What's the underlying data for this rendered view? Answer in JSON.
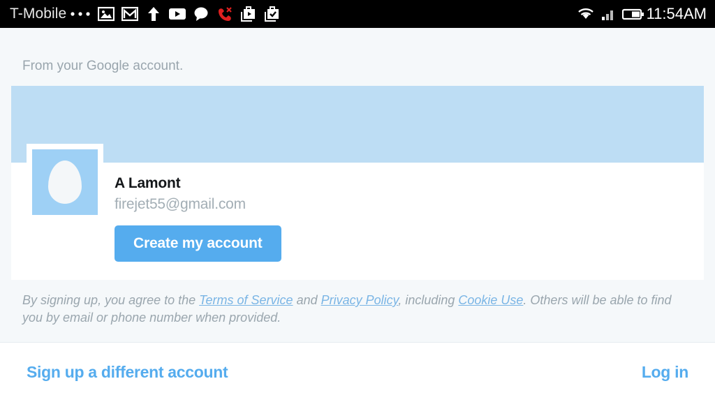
{
  "status_bar": {
    "carrier": "T-Mobile",
    "clock": "11:54AM",
    "icons": [
      "overflow-dots-icon",
      "photo-icon",
      "gmail-icon",
      "upload-arrow-icon",
      "youtube-icon",
      "message-bubble-icon",
      "missed-call-icon",
      "play-store-download-icon",
      "play-store-installed-icon"
    ],
    "right_icons": [
      "wifi-icon",
      "signal-icon",
      "battery-icon"
    ],
    "missed_call_color": "#e02020",
    "background": "#000000"
  },
  "page": {
    "background": "#f5f8fa",
    "subtitle": "From your Google account."
  },
  "card": {
    "banner_color": "#bdddf4",
    "background": "#ffffff",
    "avatar": {
      "name": "default-egg-avatar",
      "background": "#9ed0f5",
      "egg_color": "#f4f7f9"
    },
    "account_name": "A Lamont",
    "account_email": "firejet55@gmail.com",
    "create_button_label": "Create my account",
    "accent_color": "#55acee"
  },
  "terms": {
    "part1": "By signing up, you agree to the ",
    "link_tos": "Terms of Service",
    "part2": " and ",
    "link_privacy": "Privacy Policy",
    "part3": ", including ",
    "link_cookie": "Cookie Use",
    "part4": ". Others will be able to find you by email or phone number when provided."
  },
  "bottom_bar": {
    "switch_account_label": "Sign up a different account",
    "login_label": "Log in"
  }
}
